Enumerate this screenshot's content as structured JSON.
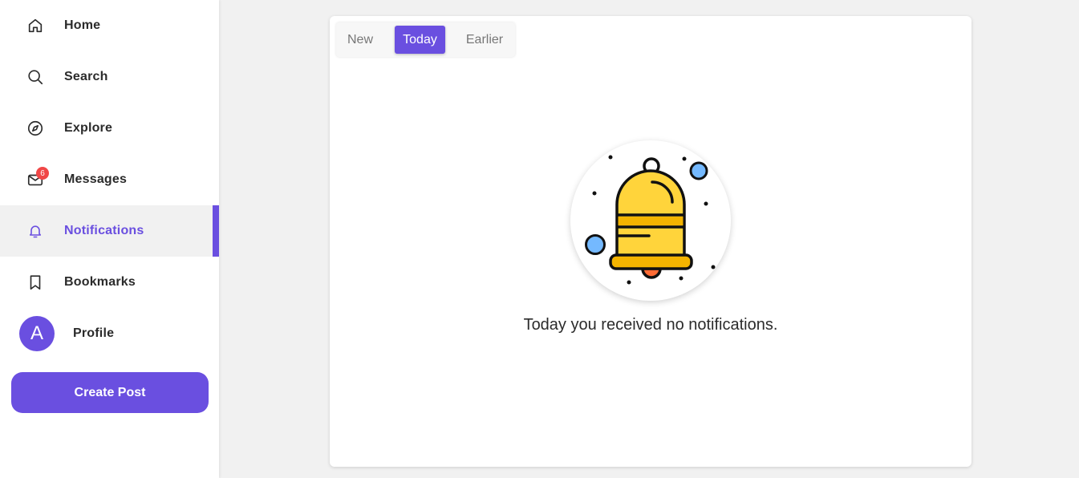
{
  "sidebar": {
    "items": [
      {
        "label": "Home",
        "icon": "home-icon"
      },
      {
        "label": "Search",
        "icon": "search-icon"
      },
      {
        "label": "Explore",
        "icon": "compass-icon"
      },
      {
        "label": "Messages",
        "icon": "mail-icon",
        "badge": "6"
      },
      {
        "label": "Notifications",
        "icon": "bell-icon",
        "active": true
      },
      {
        "label": "Bookmarks",
        "icon": "bookmark-icon"
      },
      {
        "label": "Profile",
        "avatar": "A"
      }
    ],
    "create_post_label": "Create Post"
  },
  "notifications": {
    "tabs": [
      {
        "label": "New"
      },
      {
        "label": "Today",
        "active": true
      },
      {
        "label": "Earlier"
      }
    ],
    "empty_message": "Today you received no notifications.",
    "illustration": "bell-illustration-icon"
  },
  "colors": {
    "accent": "#6a4fe0",
    "badge": "#f04747",
    "background": "#f1f1f1",
    "bell_yellow": "#ffd43b",
    "bell_orange": "#f4b400",
    "bubble_blue": "#74b9ff"
  }
}
